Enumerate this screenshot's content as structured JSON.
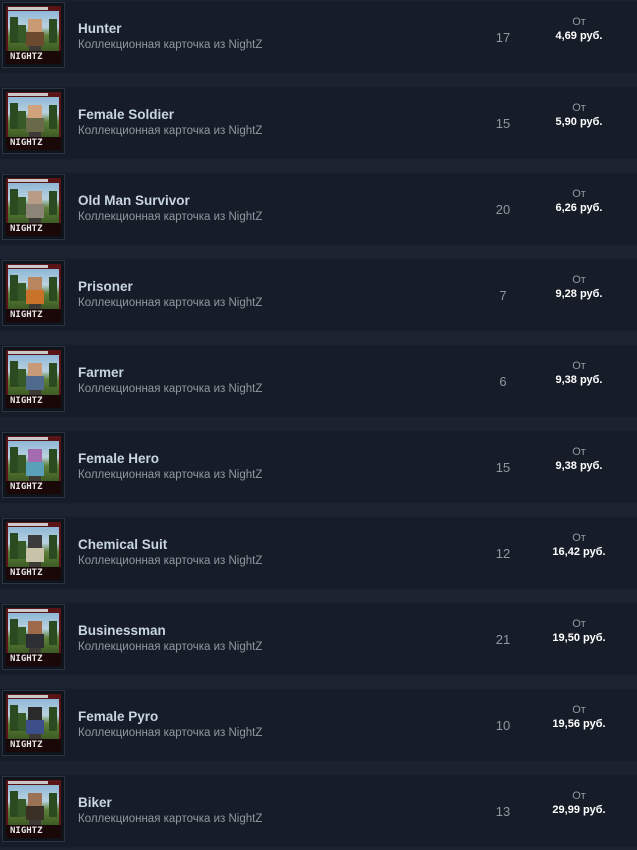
{
  "listing": {
    "items": [
      {
        "name": "Hunter",
        "subtitle": "Коллекционная карточка из NightZ",
        "quantity": "17",
        "price_prefix": "От",
        "price": "4,69 руб.",
        "outfit_color": "#6b4a2e",
        "head_color": "#c99a74"
      },
      {
        "name": "Female Soldier",
        "subtitle": "Коллекционная карточка из NightZ",
        "quantity": "15",
        "price_prefix": "От",
        "price": "5,90 руб.",
        "outfit_color": "#6a6a4a",
        "head_color": "#d1a37c"
      },
      {
        "name": "Old Man Survivor",
        "subtitle": "Коллекционная карточка из NightZ",
        "quantity": "20",
        "price_prefix": "От",
        "price": "6,26 руб.",
        "outfit_color": "#8a8577",
        "head_color": "#b89c86"
      },
      {
        "name": "Prisoner",
        "subtitle": "Коллекционная карточка из NightZ",
        "quantity": "7",
        "price_prefix": "От",
        "price": "9,28 руб.",
        "outfit_color": "#c9722a",
        "head_color": "#b8865e"
      },
      {
        "name": "Farmer",
        "subtitle": "Коллекционная карточка из NightZ",
        "quantity": "6",
        "price_prefix": "От",
        "price": "9,38 руб.",
        "outfit_color": "#4f6a8c",
        "head_color": "#c89a78"
      },
      {
        "name": "Female Hero",
        "subtitle": "Коллекционная карточка из NightZ",
        "quantity": "15",
        "price_prefix": "От",
        "price": "9,38 руб.",
        "outfit_color": "#5aa0b8",
        "head_color": "#a46bb0"
      },
      {
        "name": "Chemical Suit",
        "subtitle": "Коллекционная карточка из NightZ",
        "quantity": "12",
        "price_prefix": "От",
        "price": "16,42 руб.",
        "outfit_color": "#c8c3a8",
        "head_color": "#3b3b3b"
      },
      {
        "name": "Businessman",
        "subtitle": "Коллекционная карточка из NightZ",
        "quantity": "21",
        "price_prefix": "От",
        "price": "19,50 руб.",
        "outfit_color": "#2e2e35",
        "head_color": "#9e6a4a"
      },
      {
        "name": "Female Pyro",
        "subtitle": "Коллекционная карточка из NightZ",
        "quantity": "10",
        "price_prefix": "От",
        "price": "19,56 руб.",
        "outfit_color": "#3d4f8a",
        "head_color": "#2a2a2a"
      },
      {
        "name": "Biker",
        "subtitle": "Коллекционная карточка из NightZ",
        "quantity": "13",
        "price_prefix": "От",
        "price": "29,99 руб.",
        "outfit_color": "#3a3026",
        "head_color": "#9c7256"
      }
    ],
    "thumbnail_logo": "NIGHTZ"
  }
}
